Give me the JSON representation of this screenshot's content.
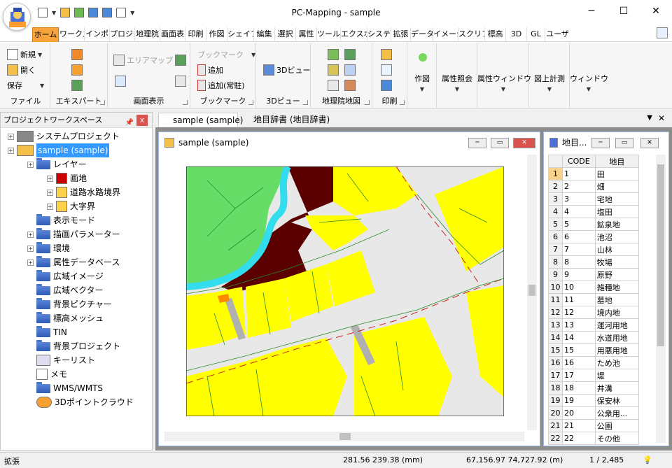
{
  "app": {
    "title": "PC-Mapping - sample"
  },
  "ribbon_tabs": [
    "ホーム",
    "ワークス",
    "インポ",
    "プロジェ",
    "地理院",
    "画面表",
    "印刷",
    "作図",
    "シェイプ",
    "編集",
    "選択",
    "属性",
    "ツール",
    "エクスポ",
    "システ",
    "拡張",
    "データ",
    "イメージ",
    "スクリプ",
    "標高",
    "3D",
    "GL",
    "ユーザ"
  ],
  "ribbon": {
    "file": {
      "label": "ファイル",
      "new": "新規",
      "open": "開く",
      "save": "保存"
    },
    "export": {
      "label": "エキスパート"
    },
    "view": {
      "label": "画面表示",
      "area_map": "エリアマップ"
    },
    "bookmark": {
      "label": "ブックマーク",
      "bookmark": "ブックマーク",
      "add": "追加",
      "add_always": "追加(常駐)"
    },
    "view3d": {
      "label": "3Dビュー",
      "btn": "3Dビュー"
    },
    "gsi": {
      "label": "地理院地図"
    },
    "print": {
      "label": "印刷"
    },
    "draw": "作図",
    "attr_ref": "属性照会",
    "attr_window": "属性ウィンドウ",
    "measure": "図上計測",
    "window": "ウィンドウ"
  },
  "project": {
    "title": "プロジェクトワークスペース",
    "tree": [
      "システムプロジェクト",
      "sample (sample)",
      "レイヤー",
      "画地",
      "道路水路境界",
      "大字界",
      "表示モード",
      "描画パラメーター",
      "環境",
      "属性データベース",
      "広域イメージ",
      "広域ベクター",
      "背景ピクチャー",
      "標高メッシュ",
      "TIN",
      "背景プロジェクト",
      "キーリスト",
      "メモ",
      "WMS/WMTS",
      "3Dポイントクラウド"
    ]
  },
  "doc_tabs": [
    "sample (sample)",
    "地目辞書 (地目辞書)"
  ],
  "map_window": {
    "title": "sample (sample)"
  },
  "dict_window": {
    "title": "地目...",
    "headers": [
      "CODE",
      "地目"
    ],
    "rows": [
      [
        "1",
        "1",
        "田"
      ],
      [
        "2",
        "2",
        "畑"
      ],
      [
        "3",
        "3",
        "宅地"
      ],
      [
        "4",
        "4",
        "塩田"
      ],
      [
        "5",
        "5",
        "鉱泉地"
      ],
      [
        "6",
        "6",
        "池沼"
      ],
      [
        "7",
        "7",
        "山林"
      ],
      [
        "8",
        "8",
        "牧場"
      ],
      [
        "9",
        "9",
        "原野"
      ],
      [
        "10",
        "10",
        "雑種地"
      ],
      [
        "11",
        "11",
        "墓地"
      ],
      [
        "12",
        "12",
        "境内地"
      ],
      [
        "13",
        "13",
        "運河用地"
      ],
      [
        "14",
        "14",
        "水道用地"
      ],
      [
        "15",
        "15",
        "用悪用地"
      ],
      [
        "16",
        "16",
        "ため池"
      ],
      [
        "17",
        "17",
        "堤"
      ],
      [
        "18",
        "18",
        "井溝"
      ],
      [
        "19",
        "19",
        "保安林"
      ],
      [
        "20",
        "20",
        "公衆用..."
      ],
      [
        "21",
        "21",
        "公園"
      ],
      [
        "22",
        "22",
        "その他"
      ]
    ]
  },
  "status": {
    "mode": "拡張",
    "screen_coord": "281.56 239.38 (mm)",
    "world_coord": "67,156.97 74,727.92 (m)",
    "page": "1 / 2,485"
  },
  "colors": {
    "accent": "#f6a33b",
    "parcel": "#ffff00",
    "green": "#66dd66",
    "dark": "#5a0000",
    "water": "#33ddee",
    "road": "#e8e8e8"
  }
}
